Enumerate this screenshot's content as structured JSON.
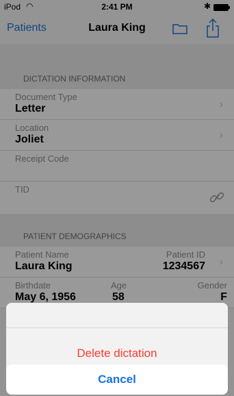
{
  "status_bar": {
    "carrier": "iPod",
    "wifi_icon": "wifi-icon",
    "time": "2:41 PM",
    "bluetooth_icon": "bluetooth-icon",
    "battery_icon": "battery-icon"
  },
  "navbar": {
    "back_label": "Patients",
    "title": "Laura King",
    "folder_icon": "folder-icon",
    "share_icon": "share-icon"
  },
  "dictation_information": {
    "header": "DICTATION INFORMATION",
    "document_type": {
      "label": "Document Type",
      "value": "Letter"
    },
    "location": {
      "label": "Location",
      "value": "Joliet"
    },
    "receipt_code": {
      "label": "Receipt Code",
      "value": ""
    },
    "tid": {
      "label": "TID",
      "icon": "link-icon"
    }
  },
  "patient_demographics": {
    "header": "PATIENT DEMOGRAPHICS",
    "patient_name": {
      "label": "Patient Name",
      "value": "Laura King"
    },
    "patient_id": {
      "label": "Patient ID",
      "value": "1234567"
    },
    "birthdate": {
      "label": "Birthdate",
      "value": "May 6, 1956"
    },
    "age": {
      "label": "Age",
      "value": "58"
    },
    "gender": {
      "label": "Gender",
      "value": "F"
    }
  },
  "action_sheet": {
    "delete_label": "Delete dictation",
    "cancel_label": "Cancel",
    "delete_color": "#ff3b30",
    "cancel_color": "#1a73d9"
  }
}
